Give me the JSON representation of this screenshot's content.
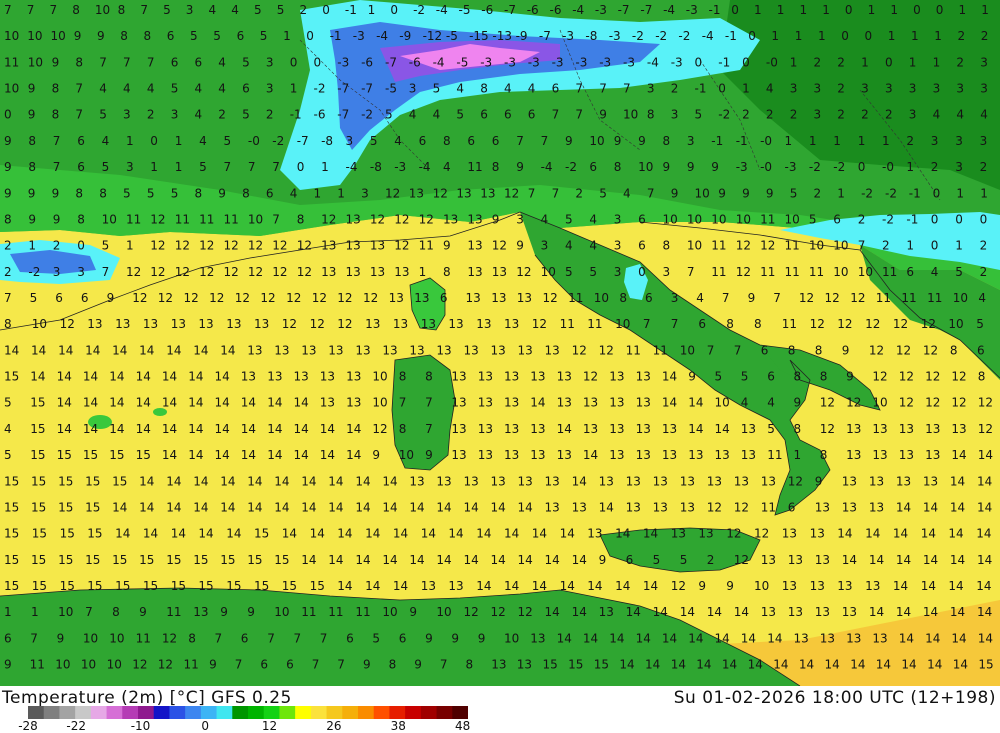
{
  "title": "Temperature (2m) [°C] GFS 0.25",
  "valid_time": "Su 01-02-2026 18:00 UTC (12+198)",
  "legend": {
    "ticks": [
      "-28",
      "-22",
      "-10",
      "0",
      "12",
      "26",
      "38",
      "48"
    ],
    "colors": [
      "#5a5a5a",
      "#7f7f7f",
      "#a3a3a3",
      "#c8c8c8",
      "#e6a8e6",
      "#d66fd6",
      "#b53cb5",
      "#8f1a8f",
      "#1414c8",
      "#2b52e6",
      "#3d86f0",
      "#3cb4f5",
      "#40e6f0",
      "#009600",
      "#00b400",
      "#14d214",
      "#6ee60a",
      "#ffff00",
      "#fbe23c",
      "#f5c81e",
      "#f5af0a",
      "#fa8c00",
      "#ff5000",
      "#e61e00",
      "#c80000",
      "#a00000",
      "#780000",
      "#500000"
    ],
    "tick_positions": [
      0,
      0.146,
      0.341,
      0.537,
      0.732,
      0.927,
      1.122,
      1.317
    ]
  },
  "palette": {
    "cyan": "#59f2f8",
    "mid_green": "#2fa631",
    "dark_green": "#1a8c1e",
    "light_green": "#39c83c",
    "yellow": "#f5e84a",
    "orange": "#f6c83a",
    "blue": "#3f7fe6",
    "violet": "#8a56e6",
    "magenta": "#ef84ef"
  },
  "grid_values": [
    "7 7 7 8 10 8 7 5 3 4 4 5 5 2 0 -1 1 0 -2 -4 -5 -6 -7 -6 -6 -4 -3 -7 -7 -4 -3 -1 0 1 1 1 1 0 1 1 0 0 1 1",
    "10 10 10 9 9 8 8 6 5 5 6 5 1 0 -1 -3 -4 -9 -12 -5 -15 -13 -9 -7 -3 -8 -3 -2 -2 -2 -4 -1 0 1 1 1 0 0 1 1 1 2 2",
    "11 10 9 8 7 7 7 6 6 4 5 3 0 0 -3 -6 -7 -6 -4 -5 -3 -3 -3 -3 -3 -3 -3 -4 -3 0 -1 0 -0 1 2 2 1 0 1 1 2 3",
    "10 9 8 7 4 4 4 5 4 4 6 3 1 -2 -7 -7 -5 3 5 4 8 4 4 6 7 7 7 3 2 -1 0 1 4 3 3 2 3 3 3 3 3 3",
    "0 9 8 7 5 3 2 3 4 2 5 2 -1 -6 -7 -2 5 4 4 5 6 6 6 7 7 9 10 8 3 5 -2 2 2 2 3 2 2 2 3 4 4 4",
    "9 8 7 6 4 1 0 1 4 5 -0 -2 -7 -8 3 5 4 6 8 6 6 7 7 9 10 9 9 8 3 -1 -1 -0 1 1 1 1 1 2 3 3 3",
    "9 8 7 6 5 3 1 1 5 7 7 7 0 1 -4 -8 -3 -4 4 11 8 9 -4 -2 6 8 10 9 9 9 -3 -0 -3 -2 -2 0 -0 1 2 3 2",
    "9 9 9 8 8 5 5 5 8 9 8 6 4 1 1 3 12 13 12 13 13 12 7 7 2 5 4 7 9 10 9 9 9 5 2 1 -2 -2 -1 0 1 1",
    "8 9 9 8 10 11 12 11 11 11 10 7 8 12 13 12 12 12 13 13 9 3 4 5 4 3 6 10 10 10 10 11 10 5 6 2 -2 -1 0 0 0",
    "2 1 2 0 5 1 12 12 12 12 12 12 12 13 13 13 12 11 9 13 12 9 3 4 4 3 6 8 10 11 12 12 11 10 10 7 2 1 0 1 2",
    "2 -2 3 3 7 12 12 12 12 12 12 12 12 13 13 13 13 1 8 13 13 12 10 5 5 3 0 3 7 11 12 11 11 11 10 10 11 6 4 5 2",
    "7 5 6 6 9 12 12 12 12 12 12 12 12 12 12 13 13 6 13 13 13 12 11 10 8 6 3 4 7 9 7 12 12 12 11 11 11 10 4",
    "8 10 12 13 13 13 13 13 13 13 12 12 12 13 13 13 13 13 13 12 11 11 10 7 7 6 8 8 11 12 12 12 12 12 10 5",
    "14 14 14 14 14 14 14 14 14 13 13 13 13 13 13 13 13 13 13 13 13 12 12 11 11 10 7 7 6 8 8 9 12 12 12 8 6",
    "15 14 14 14 14 14 14 14 14 13 13 13 13 13 10 8 8 13 13 13 13 13 12 13 13 14 9 5 5 6 8 8 9 12 12 12 12 8",
    "5 15 14 14 14 14 14 14 14 14 14 14 13 13 10 7 7 13 13 13 14 13 13 13 13 14 14 10 4 4 9 12 12 10 12 12 12 12",
    "4 15 14 14 14 14 14 14 14 14 14 14 14 14 12 8 7 13 13 13 13 14 13 13 13 13 14 14 13 5 8 12 13 13 13 13 13 12",
    "5 15 15 15 15 15 14 14 14 14 14 14 14 14 9 10 9 13 13 13 13 13 14 13 13 13 13 13 13 11 1 8 13 13 13 13 14 14",
    "15 15 15 15 15 14 14 14 14 14 14 14 14 14 14 13 13 13 13 13 13 14 13 13 13 13 13 13 13 12 9 13 13 13 13 14 14",
    "15 15 15 15 14 14 14 14 14 14 14 14 14 14 14 14 14 14 14 14 13 13 14 13 13 13 12 12 11 6 13 13 13 14 14 14 14",
    "15 15 15 15 14 14 14 14 14 15 14 14 14 14 14 14 14 14 14 14 14 13 14 14 13 13 12 12 13 13 14 14 14 14 14 14",
    "15 15 15 15 15 15 15 15 15 15 15 14 14 14 14 14 14 14 14 14 14 14 9 6 5 5 2 12 13 13 13 14 14 14 14 14 14",
    "15 15 15 15 15 15 15 15 15 15 15 15 14 14 14 13 13 14 14 14 14 14 14 14 12 9 9 10 13 13 13 13 14 14 14 14",
    "1 1 10 7 8 9 11 13 9 9 10 11 11 11 10 9 10 12 12 12 14 14 13 14 14 14 14 14 13 13 13 13 14 14 14 14 14",
    "6 7 9 10 10 11 12 8 7 6 7 7 7 6 5 6 9 9 9 10 13 14 14 14 14 14 14 14 14 14 13 13 13 13 14 14 14 14",
    "9 11 10 10 10 12 12 11 9 7 6 6 7 7 9 8 9 7 8 13 13 15 15 15 14 14 14 14 14 14 14 14 14 14 14 14 14 14 15"
  ]
}
